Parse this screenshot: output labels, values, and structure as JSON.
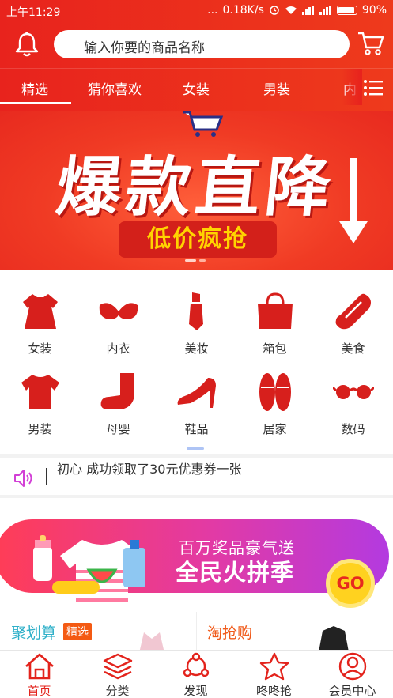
{
  "status": {
    "time": "上午11:29",
    "dots": "...",
    "speed": "0.18K/s",
    "battery": "90%"
  },
  "search": {
    "placeholder": "输入你要的商品名称"
  },
  "tabs": [
    {
      "label": "精选",
      "active": true
    },
    {
      "label": "猜你喜欢"
    },
    {
      "label": "女装"
    },
    {
      "label": "男装"
    },
    {
      "label": "内"
    }
  ],
  "banner": {
    "title": "爆款直降",
    "subtitle": "低价疯抢"
  },
  "categories": [
    {
      "label": "女装",
      "icon": "dress-icon"
    },
    {
      "label": "内衣",
      "icon": "bra-icon"
    },
    {
      "label": "美妆",
      "icon": "lipstick-icon"
    },
    {
      "label": "箱包",
      "icon": "handbag-icon"
    },
    {
      "label": "美食",
      "icon": "food-icon"
    },
    {
      "label": "男装",
      "icon": "tshirt-icon"
    },
    {
      "label": "母婴",
      "icon": "baby-sock-icon"
    },
    {
      "label": "鞋品",
      "icon": "high-heel-icon"
    },
    {
      "label": "居家",
      "icon": "slippers-icon"
    },
    {
      "label": "数码",
      "icon": "glasses-icon"
    }
  ],
  "notice": {
    "message": "初心 成功领取了30元优惠券一张"
  },
  "promo": {
    "line1": "百万奖品豪气送",
    "line2": "全民火拼季",
    "go": "GO"
  },
  "sections": [
    {
      "title": "聚划算",
      "badge": "精选"
    },
    {
      "title": "淘抢购"
    }
  ],
  "nav": [
    {
      "label": "首页",
      "icon": "home-icon",
      "active": true
    },
    {
      "label": "分类",
      "icon": "layers-icon"
    },
    {
      "label": "发现",
      "icon": "discover-icon"
    },
    {
      "label": "咚咚抢",
      "icon": "star-icon"
    },
    {
      "label": "会员中心",
      "icon": "user-icon"
    }
  ],
  "colors": {
    "primary": "#e8231d",
    "active_nav": "#e3231c",
    "icon_red": "#d71f1c"
  }
}
